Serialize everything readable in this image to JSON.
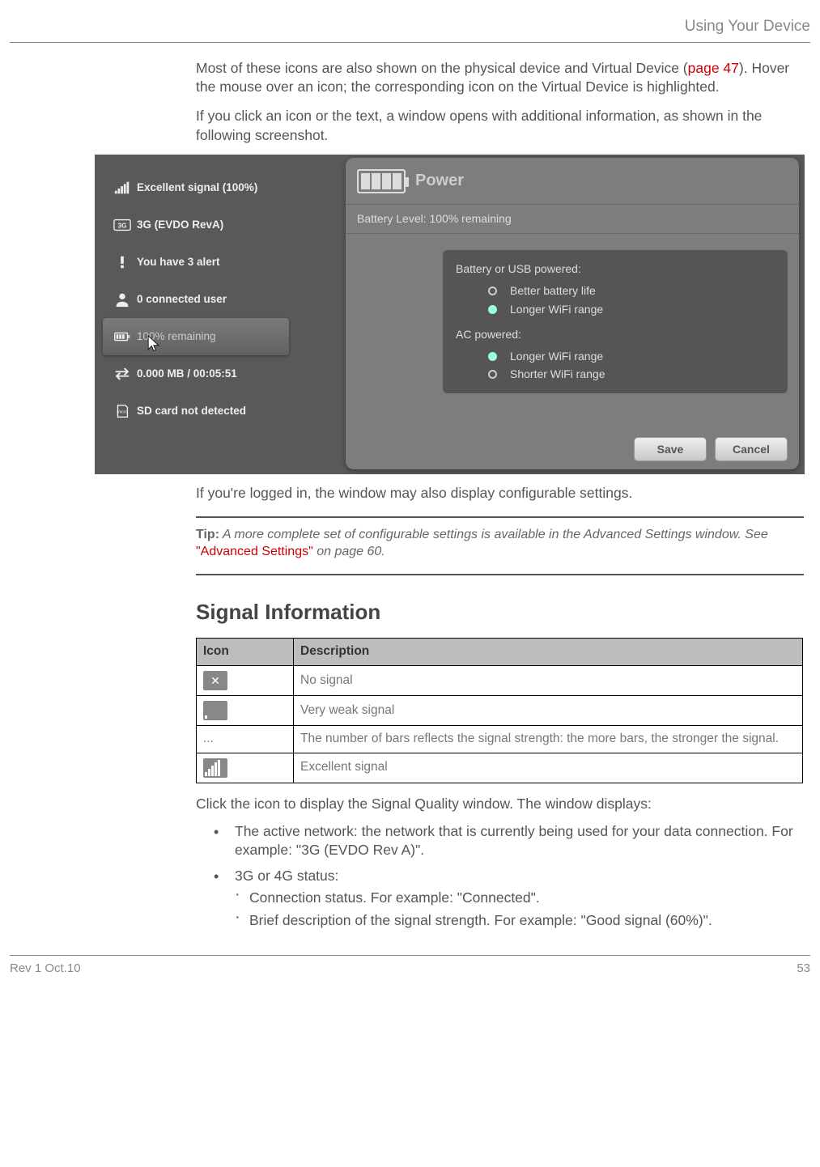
{
  "header": {
    "section_title": "Using Your Device"
  },
  "intro": {
    "p1_a": "Most of these icons are also shown on the physical device and Virtual Device (",
    "p1_link": "page 47",
    "p1_b": "). Hover the mouse over an icon; the corresponding icon on the Virtual Device is highlighted.",
    "p2": "If you click an icon or the text, a window opens with additional information, as shown in the following screenshot."
  },
  "screenshot": {
    "rows": [
      {
        "icon": "signal-icon",
        "label": "Excellent signal (100%)"
      },
      {
        "icon": "3g-icon",
        "label": "3G (EVDO RevA)"
      },
      {
        "icon": "alert-icon",
        "label": "You have 3 alert"
      },
      {
        "icon": "user-icon",
        "label": "0 connected user"
      },
      {
        "icon": "battery-icon",
        "label": "100% remaining",
        "active": true
      },
      {
        "icon": "data-icon",
        "label": "0.000 MB / 00:05:51"
      },
      {
        "icon": "sd-icon",
        "label": "SD card not detected"
      }
    ],
    "panel": {
      "title": "Power",
      "subtitle": "Battery Level: 100% remaining",
      "group1_label": "Battery or USB powered:",
      "group1": [
        {
          "label": "Better battery life",
          "selected": false
        },
        {
          "label": "Longer WiFi range",
          "selected": true
        }
      ],
      "group2_label": "AC powered:",
      "group2": [
        {
          "label": "Longer WiFi range",
          "selected": true
        },
        {
          "label": "Shorter WiFi range",
          "selected": false
        }
      ],
      "save": "Save",
      "cancel": "Cancel"
    }
  },
  "after_shot": "If you're logged in, the window may also display configurable settings.",
  "tip": {
    "label": "Tip:",
    "text_a": " A more complete set of configurable settings is available in the Advanced Settings window. See ",
    "link": "\"Advanced Settings\"",
    "text_b": " on page 60."
  },
  "section_heading": "Signal Information",
  "table": {
    "h1": "Icon",
    "h2": "Description",
    "rows": [
      {
        "icon": "no-signal-icon",
        "desc": "No signal"
      },
      {
        "icon": "weak-signal-icon",
        "desc": "Very weak signal"
      },
      {
        "icon": "ellipsis",
        "desc": "The number of bars reflects the signal strength: the more bars, the stronger the signal."
      },
      {
        "icon": "excellent-signal-icon",
        "desc": "Excellent signal"
      }
    ]
  },
  "post": {
    "p": "Click the icon to display the Signal Quality window. The window displays:",
    "b1": "The active network: the network that is currently being used for your data connection. For example: \"3G (EVDO Rev A)\".",
    "b2": "3G or 4G status:",
    "b2a": "Connection status. For example: \"Connected\".",
    "b2b": "Brief description of the signal strength. For example: \"Good signal (60%)\"."
  },
  "footer": {
    "left": "Rev 1  Oct.10",
    "right": "53"
  }
}
